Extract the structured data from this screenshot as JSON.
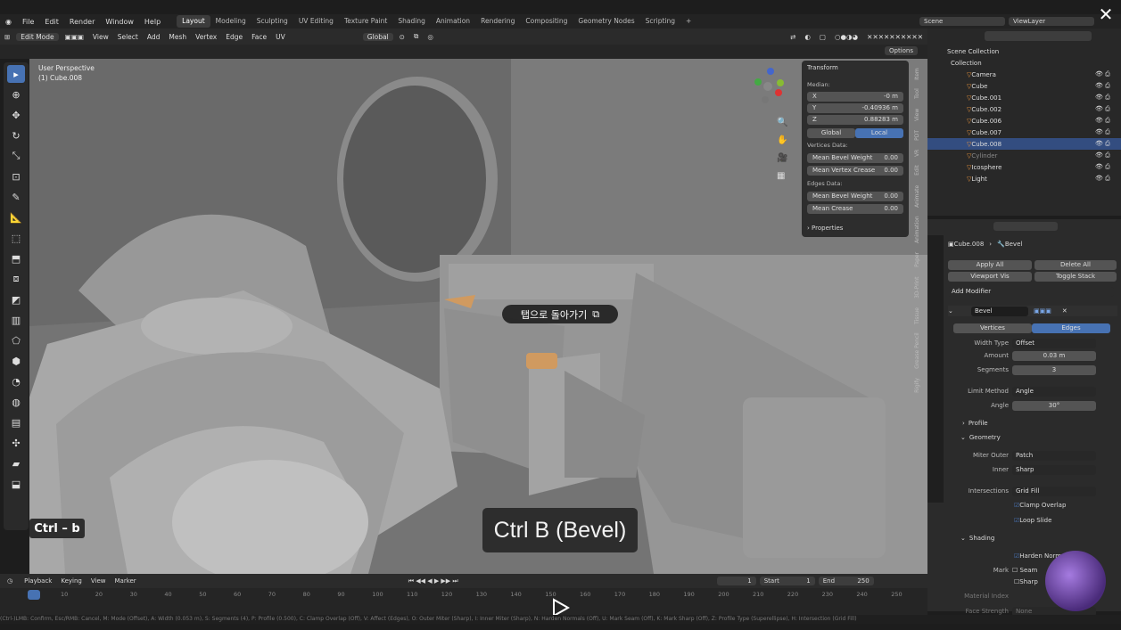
{
  "menu": [
    "File",
    "Edit",
    "Render",
    "Window",
    "Help"
  ],
  "workspaces": [
    "Layout",
    "Modeling",
    "Sculpting",
    "UV Editing",
    "Texture Paint",
    "Shading",
    "Animation",
    "Rendering",
    "Compositing",
    "Geometry Nodes",
    "Scripting"
  ],
  "scene": "Scene",
  "view_layer": "ViewLayer",
  "header": {
    "mode": "Edit Mode",
    "items": [
      "View",
      "Select",
      "Add",
      "Mesh",
      "Vertex",
      "Edge",
      "Face",
      "UV"
    ],
    "orientation": "Global",
    "options": "Options"
  },
  "viewport": {
    "perspective": "User Perspective",
    "object": "(1) Cube.008"
  },
  "transform": {
    "title": "Transform",
    "median": "Median:",
    "x_label": "X",
    "x": "-0 m",
    "y_label": "Y",
    "y": "-0.40936 m",
    "z_label": "Z",
    "z": "0.88283 m",
    "global": "Global",
    "local": "Local",
    "vertices_data": "Vertices Data:",
    "mean_bevel_weight": "Mean Bevel Weight",
    "mbw_v": "0.00",
    "mean_vertex_crease": "Mean Vertex Crease",
    "mvc_v": "0.00",
    "edges_data": "Edges Data:",
    "mbw2": "Mean Bevel Weight",
    "mbw2_v": "0.00",
    "mean_crease": "Mean Crease",
    "mc_v": "0.00",
    "properties": "Properties"
  },
  "side_tabs": [
    "Item",
    "Tool",
    "View",
    "PDT",
    "VR",
    "Edit",
    "Animate",
    "Animation",
    "Paper",
    "3D-Print",
    "Tissue",
    "Grease Pencil",
    "Rigify"
  ],
  "outliner": {
    "scene_collection": "Scene Collection",
    "collection": "Collection",
    "items": [
      "Camera",
      "Cube",
      "Cube.001",
      "Cube.002",
      "Cube.006",
      "Cube.007",
      "Cube.008",
      "Cylinder",
      "Icosphere",
      "Light"
    ]
  },
  "properties": {
    "object": "Cube.008",
    "modifier": "Bevel",
    "apply_all": "Apply All",
    "delete_all": "Delete All",
    "viewport_vis": "Viewport Vis",
    "toggle_stack": "Toggle Stack",
    "add_modifier": "Add Modifier",
    "mod_name": "Bevel",
    "vertices": "Vertices",
    "edges": "Edges",
    "width_type_l": "Width Type",
    "width_type": "Offset",
    "amount_l": "Amount",
    "amount": "0.03 m",
    "segments_l": "Segments",
    "segments": "3",
    "limit_method_l": "Limit Method",
    "limit_method": "Angle",
    "angle_l": "Angle",
    "angle": "30°",
    "profile": "Profile",
    "geometry": "Geometry",
    "miter_outer_l": "Miter Outer",
    "miter_outer": "Patch",
    "inner_l": "Inner",
    "inner": "Sharp",
    "intersections_l": "Intersections",
    "intersections": "Grid Fill",
    "clamp_overlap": "Clamp Overlap",
    "loop_slide": "Loop Slide",
    "shading": "Shading",
    "harden_normals": "Harden Norm",
    "mark_l": "Mark",
    "seam": "Seam",
    "sharp": "Sharp",
    "material_index": "Material Index",
    "face_strength": "Face Strength",
    "none": "None"
  },
  "timeline": {
    "playback": "Playback",
    "keying": "Keying",
    "view": "View",
    "marker": "Marker",
    "frame": "1",
    "start_l": "Start",
    "start": "1",
    "end_l": "End",
    "end": "250",
    "ticks": [
      "10",
      "20",
      "30",
      "40",
      "50",
      "60",
      "70",
      "80",
      "90",
      "100",
      "110",
      "120",
      "130",
      "140",
      "150",
      "160",
      "170",
      "180",
      "190",
      "200",
      "210",
      "220",
      "230",
      "240",
      "250"
    ]
  },
  "status": "(Ctrl-)LMB: Confirm, Esc/RMB: Cancel, M: Mode (Offset), A: Width (0.053 m), S: Segments (4), P: Profile (0.500), C: Clamp Overlap (Off), V: Affect (Edges), O: Outer Miter (Sharp), I: Inner Miter (Sharp), N: Harden Normals (Off), U: Mark Seam (Off), K: Mark Sharp (Off), Z: Profile Type (Superellipse), H: Intersection (Grid Fill)",
  "overlay": {
    "kbd": "Ctrl – b",
    "caption": "Ctrl B (Bevel)",
    "tooltip": "탭으로 돌아가기"
  }
}
